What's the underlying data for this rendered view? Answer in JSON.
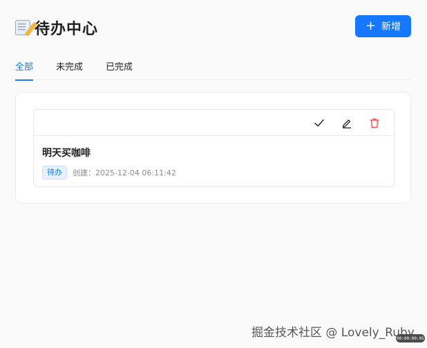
{
  "header": {
    "title": "待办中心",
    "title_icon": "memo-icon",
    "add_button_label": "新增"
  },
  "tabs": [
    {
      "label": "全部",
      "active": true
    },
    {
      "label": "未完成",
      "active": false
    },
    {
      "label": "已完成",
      "active": false
    }
  ],
  "todos": [
    {
      "title": "明天买咖啡",
      "status": "待办",
      "created": "创建：2025-12-04 06:11:42",
      "actions": [
        "check-icon",
        "edit-icon",
        "delete-icon"
      ]
    }
  ],
  "watermark": "掘金技术社区 @ Lovely_Ruby",
  "timer": "00:00:00:05",
  "colors": {
    "accent": "#1677ff",
    "danger": "#ff4d4f",
    "tag_bg": "#e6f2ff"
  }
}
